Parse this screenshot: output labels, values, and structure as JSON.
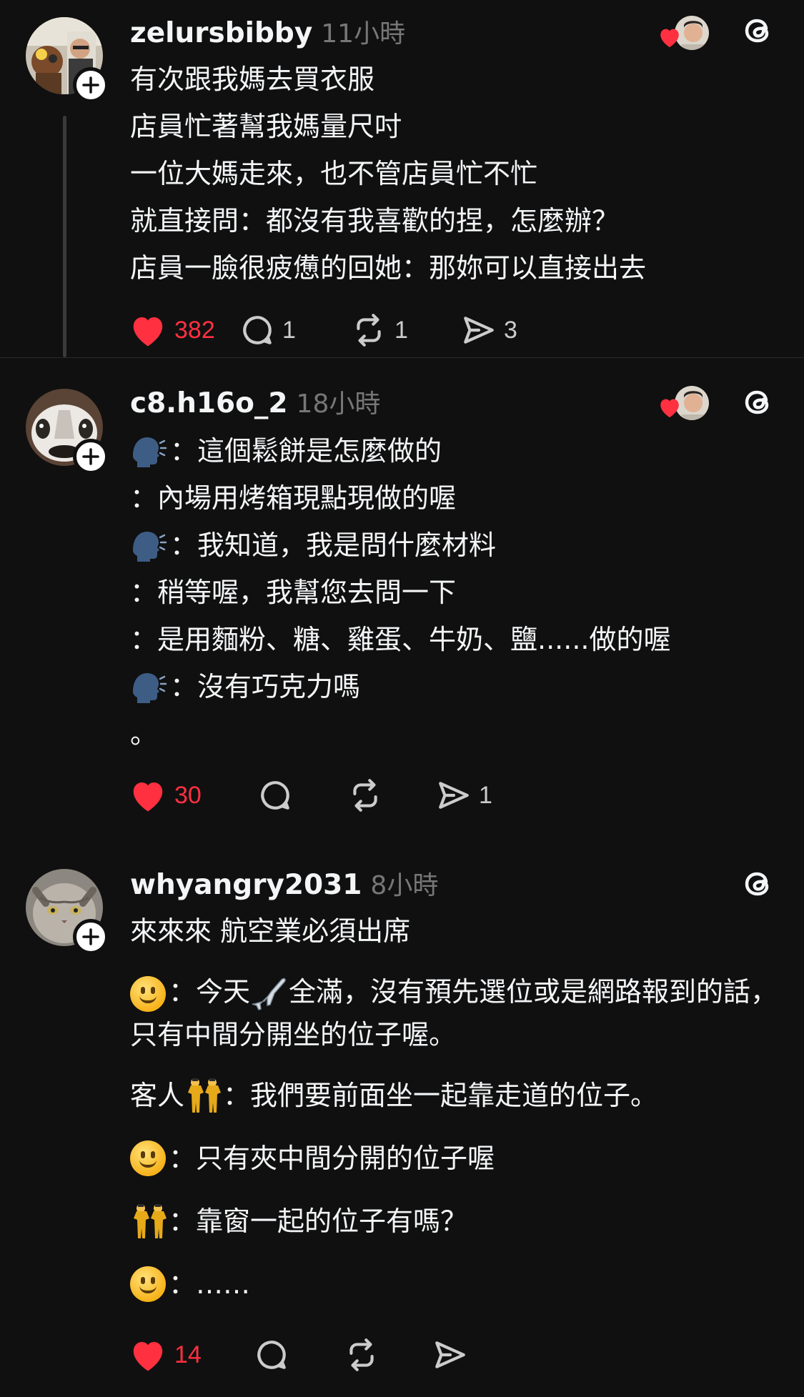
{
  "posts": [
    {
      "username": "zelursbibby",
      "time": "11小時",
      "lines": [
        "有次跟我媽去買衣服",
        "店員忙著幫我媽量尺吋",
        "一位大媽走來，也不管店員忙不忙",
        "就直接問：都沒有我喜歡的捏，怎麼辦？",
        "店員一臉很疲憊的回她：那妳可以直接出去"
      ],
      "likes": "382",
      "replies": "1",
      "reposts": "1",
      "shares": "3"
    },
    {
      "username": "c8.h16o_2",
      "time": "18小時",
      "lines": [
        "：這個鬆餅是怎麼做的",
        "：內場用烤箱現點現做的喔",
        "：我知道，我是問什麼材料",
        "：稍等喔，我幫您去問一下",
        "：是用麵粉、糖、雞蛋、牛奶、鹽......做的喔",
        "：沒有巧克力嗎",
        "。"
      ],
      "likes": "30",
      "shares": "1"
    },
    {
      "username": "whyangry2031",
      "time": "8小時",
      "line1": "來來來 航空業必須出席",
      "line2a": "：今天",
      "line2b": "全滿，沒有預先選位或是網路報到的話，只有中間分開坐的位子喔。",
      "line3a": "客人",
      "line3b": "：我們要前面坐一起靠走道的位子。",
      "line4": "：只有夾中間分開的位子喔",
      "line5": "：靠窗一起的位子有嗎？",
      "line6": "：……",
      "likes": "14"
    }
  ],
  "colors": {
    "background": "#101010",
    "like": "#ff3040",
    "secondary": "#777777"
  },
  "icons": [
    "heart-icon",
    "comment-icon",
    "repost-icon",
    "share-icon",
    "threads-logo-icon",
    "plus-icon",
    "speaking-head-icon",
    "smile-icon",
    "airplane-icon",
    "people-icon"
  ]
}
